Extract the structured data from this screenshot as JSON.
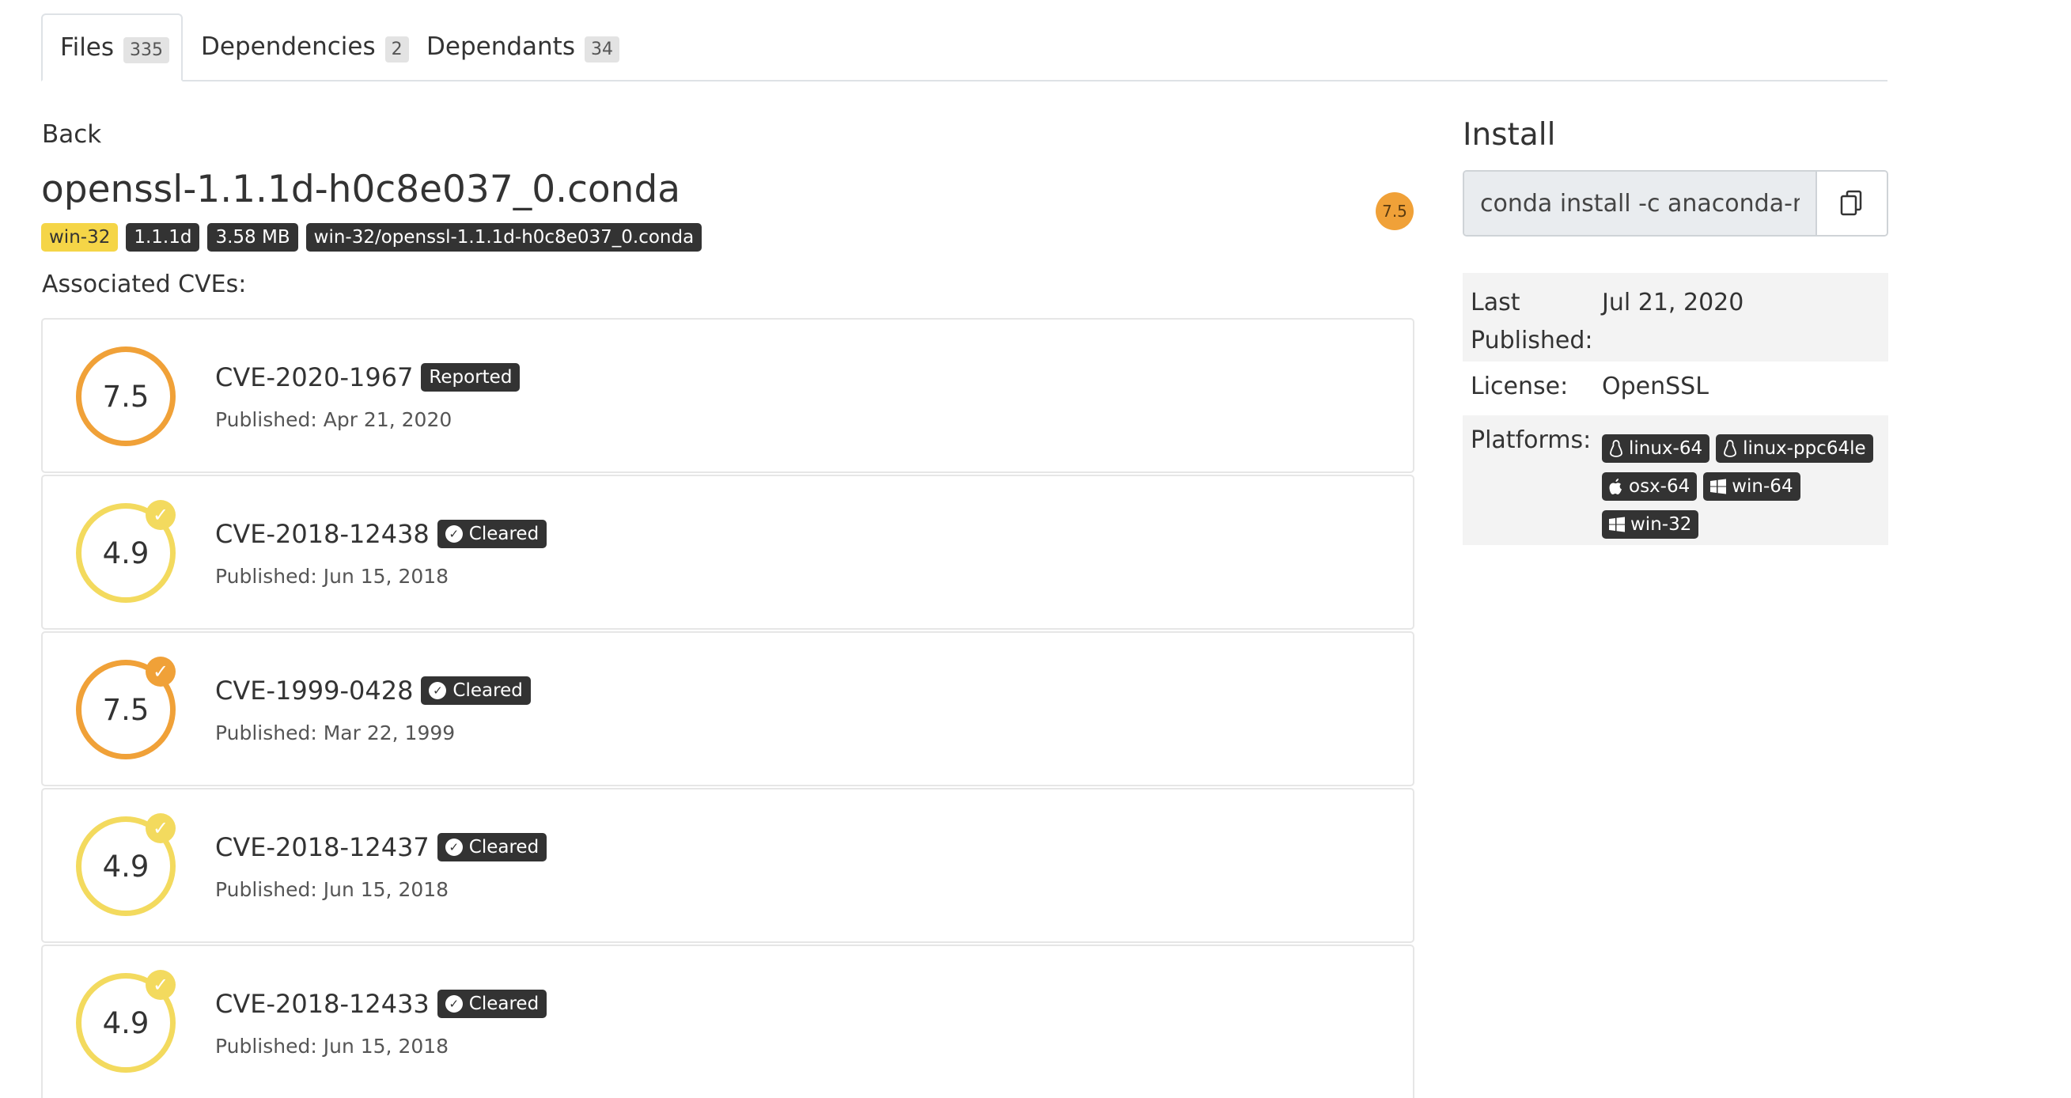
{
  "tabs": [
    {
      "label": "Files",
      "count": "335"
    },
    {
      "label": "Dependencies",
      "count": "2"
    },
    {
      "label": "Dependants",
      "count": "34"
    }
  ],
  "back_label": "Back",
  "file": {
    "title": "openssl-1.1.1d-h0c8e037_0.conda",
    "score": "7.5",
    "badges": {
      "platform": "win-32",
      "version": "1.1.1d",
      "size": "3.58 MB",
      "path": "win-32/openssl-1.1.1d-h0c8e037_0.conda"
    }
  },
  "associated_label": "Associated CVEs:",
  "cves": [
    {
      "score": "7.5",
      "id": "CVE-2020-1967",
      "status": "Reported",
      "published": "Published: Apr 21, 2020"
    },
    {
      "score": "4.9",
      "id": "CVE-2018-12438",
      "status": "Cleared",
      "published": "Published: Jun 15, 2018"
    },
    {
      "score": "7.5",
      "id": "CVE-1999-0428",
      "status": "Cleared",
      "published": "Published: Mar 22, 1999"
    },
    {
      "score": "4.9",
      "id": "CVE-2018-12437",
      "status": "Cleared",
      "published": "Published: Jun 15, 2018"
    },
    {
      "score": "4.9",
      "id": "CVE-2018-12433",
      "status": "Cleared",
      "published": "Published: Jun 15, 2018"
    }
  ],
  "install": {
    "title": "Install",
    "command": "conda install -c anaconda-main openssl"
  },
  "meta": {
    "last_published_label_1": "Last",
    "last_published_label_2": "Published:",
    "last_published_value": "Jul 21, 2020",
    "license_label": "License:",
    "license_value": "OpenSSL",
    "platforms_label": "Platforms:",
    "platforms": [
      "linux-64",
      "linux-ppc64le",
      "osx-64",
      "win-64",
      "win-32"
    ]
  },
  "colors": {
    "high_score": "#f0a138",
    "medium_score": "#f3da5e",
    "badge_dark": "#333333",
    "badge_yellow": "#f5d547"
  }
}
